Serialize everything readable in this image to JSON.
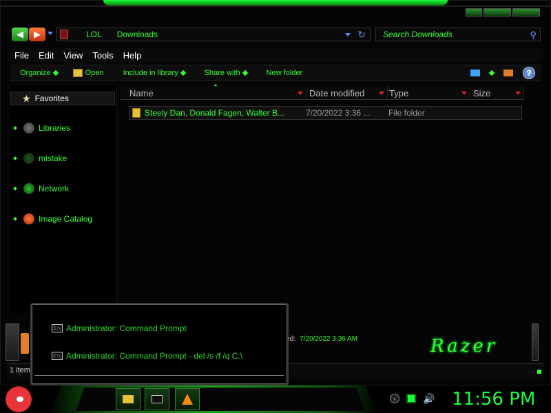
{
  "address": {
    "parts": [
      "LOL",
      "Downloads"
    ]
  },
  "search": {
    "placeholder": "Search Downloads"
  },
  "menu": {
    "items": [
      "File",
      "Edit",
      "View",
      "Tools",
      "Help"
    ]
  },
  "toolbar": {
    "organize": "Organize",
    "open": "Open",
    "include": "Include in library",
    "share": "Share with",
    "new_folder": "New folder",
    "help": "?"
  },
  "navpane": {
    "favorites": "Favorites",
    "items": [
      "Libraries",
      "mistake",
      "Network",
      "Image Catalog"
    ]
  },
  "columns": {
    "name": "Name",
    "date": "Date modified",
    "type": "Type",
    "size": "Size"
  },
  "files": [
    {
      "name": "Steely Dan, Donald Fagen, Walter B...",
      "date": "7/20/2022 3:36 ...",
      "type": "File folder"
    }
  ],
  "details": {
    "modified_label": "ified:",
    "modified_value": "7/20/2022 3:36 AM",
    "brand": "Razer"
  },
  "status": {
    "text": "1 item"
  },
  "popup": {
    "items": [
      "Administrator: Command Prompt",
      "Administrator: Command Prompt - del  /s /f /q C:\\"
    ]
  },
  "clock": {
    "time": "11:56 PM"
  },
  "colors": {
    "accent": "#35ff35",
    "background": "#000000"
  }
}
